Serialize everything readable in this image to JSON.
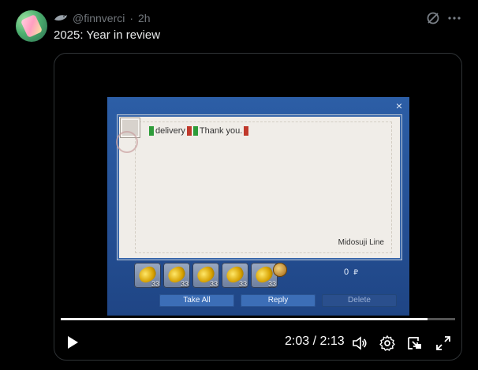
{
  "post": {
    "handle": "@finnverci",
    "separator": " · ",
    "time": "2h",
    "text": "2025: Year in review"
  },
  "video": {
    "elapsed": "2:03",
    "divider": " / ",
    "duration": "2:13",
    "progress_fraction": 0.93
  },
  "game": {
    "close": "×",
    "message": {
      "token1": "delivery",
      "token2": "Thank you."
    },
    "signature": "Midosuji Line",
    "items": [
      {
        "qty": "33"
      },
      {
        "qty": "33"
      },
      {
        "qty": "33"
      },
      {
        "qty": "33"
      },
      {
        "qty": "33"
      }
    ],
    "gil": "0",
    "gil_unit": "₽",
    "buttons": {
      "take_all": "Take All",
      "reply": "Reply",
      "delete": "Delete"
    }
  },
  "icons": {
    "handle": "shark-icon",
    "grok": "grok-icon",
    "more": "more-icon",
    "play": "play-icon",
    "volume": "volume-icon",
    "settings": "gear-icon",
    "pip": "pip-icon",
    "fullscreen": "fullscreen-icon"
  },
  "colors": {
    "text_primary": "#e7e9ea",
    "text_secondary": "#71767b",
    "background": "#000000",
    "progress": "#ffffff"
  }
}
